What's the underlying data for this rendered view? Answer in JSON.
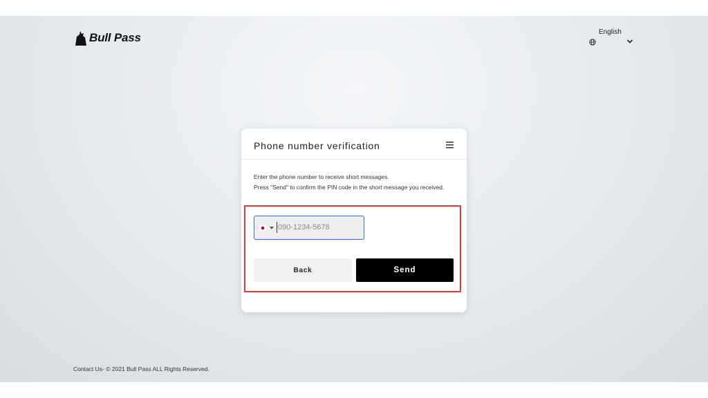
{
  "brand": {
    "name": "Bull Pass",
    "logo_icon": "bull-logo-icon"
  },
  "language": {
    "selected": "English",
    "icon": "globe-icon",
    "dropdown_icon": "chevron-down-icon"
  },
  "card": {
    "title": "Phone number verification",
    "menu_icon": "hamburger-menu-icon",
    "instructions": [
      "Enter the phone number to receive short messages.",
      "Press \"Send\" to confirm the PIN code in the short message you received."
    ],
    "phone": {
      "country_flag": "japan-flag-icon",
      "value": "",
      "placeholder": "090-1234-5678"
    },
    "back_label": "Back",
    "send_label": "Send"
  },
  "colors": {
    "highlight_border": "#e53935",
    "input_border": "#3b6fc5",
    "send_button_bg": "#000000",
    "back_button_bg": "#f1f1f1",
    "flag_red": "#bc002d"
  },
  "footer": {
    "text": "Contact Us- © 2021 Bull Pass ALL Rights Reserved."
  }
}
